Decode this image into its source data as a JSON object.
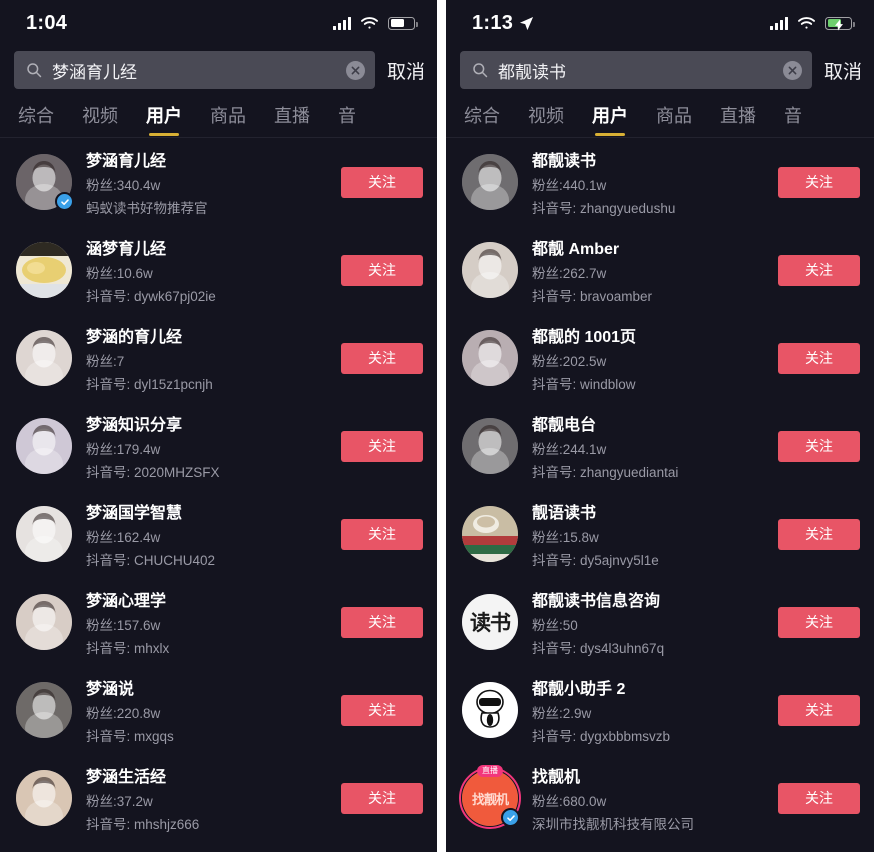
{
  "panels": [
    {
      "id": "left",
      "status": {
        "time": "1:04",
        "location_arrow": false,
        "battery_charging": false,
        "battery_level": 60
      },
      "search": {
        "value": "梦涵育儿经",
        "placeholder": "搜索",
        "cancel_label": "取消",
        "search_icon": "search-icon",
        "clear_icon": "clear-circle-icon"
      },
      "tabs": [
        {
          "label": "综合",
          "active": false
        },
        {
          "label": "视频",
          "active": false
        },
        {
          "label": "用户",
          "active": true
        },
        {
          "label": "商品",
          "active": false
        },
        {
          "label": "直播",
          "active": false
        },
        {
          "label": "音",
          "active": false
        }
      ],
      "follow_label": "关注",
      "users": [
        {
          "name": "梦涵育儿经",
          "fans": "粉丝:340.4w",
          "sub": "蚂蚁读书好物推荐官",
          "verified": true,
          "live": false,
          "avatar_kind": "photo",
          "avatar_color": "#6b6468",
          "avatar_text": ""
        },
        {
          "name": "涵梦育儿经",
          "fans": "粉丝:10.6w",
          "sub": "抖音号: dywk67pj02ie",
          "verified": false,
          "live": false,
          "avatar_kind": "food",
          "avatar_color": "#e4cf86",
          "avatar_text": ""
        },
        {
          "name": "梦涵的育儿经",
          "fans": "粉丝:7",
          "sub": "抖音号: dyl15z1pcnjh",
          "verified": false,
          "live": false,
          "avatar_kind": "photo",
          "avatar_color": "#ded6d2",
          "avatar_text": ""
        },
        {
          "name": "梦涵知识分享",
          "fans": "粉丝:179.4w",
          "sub": "抖音号: 2020MHZSFX",
          "verified": false,
          "live": false,
          "avatar_kind": "photo",
          "avatar_color": "#cfc8d6",
          "avatar_text": ""
        },
        {
          "name": "梦涵国学智慧",
          "fans": "粉丝:162.4w",
          "sub": "抖音号: CHUCHU402",
          "verified": false,
          "live": false,
          "avatar_kind": "photo",
          "avatar_color": "#e6e2e0",
          "avatar_text": ""
        },
        {
          "name": "梦涵心理学",
          "fans": "粉丝:157.6w",
          "sub": "抖音号: mhxlx",
          "verified": false,
          "live": false,
          "avatar_kind": "photo",
          "avatar_color": "#d8cdc6",
          "avatar_text": ""
        },
        {
          "name": "梦涵说",
          "fans": "粉丝:220.8w",
          "sub": "抖音号: mxgqs",
          "verified": false,
          "live": false,
          "avatar_kind": "photo",
          "avatar_color": "#6e6a68",
          "avatar_text": ""
        },
        {
          "name": "梦涵生活经",
          "fans": "粉丝:37.2w",
          "sub": "抖音号: mhshjz666",
          "verified": false,
          "live": false,
          "avatar_kind": "photo",
          "avatar_color": "#d9c6b4",
          "avatar_text": ""
        }
      ]
    },
    {
      "id": "right",
      "status": {
        "time": "1:13",
        "location_arrow": true,
        "battery_charging": true,
        "battery_level": 62
      },
      "search": {
        "value": "都靓读书",
        "placeholder": "搜索",
        "cancel_label": "取消",
        "search_icon": "search-icon",
        "clear_icon": "clear-circle-icon"
      },
      "tabs": [
        {
          "label": "综合",
          "active": false
        },
        {
          "label": "视频",
          "active": false
        },
        {
          "label": "用户",
          "active": true
        },
        {
          "label": "商品",
          "active": false
        },
        {
          "label": "直播",
          "active": false
        },
        {
          "label": "音",
          "active": false
        }
      ],
      "follow_label": "关注",
      "users": [
        {
          "name": "都靓读书",
          "fans": "粉丝:440.1w",
          "sub": "抖音号: zhangyuedushu",
          "verified": false,
          "live": false,
          "avatar_kind": "photo",
          "avatar_color": "#6f6d70",
          "avatar_text": ""
        },
        {
          "name": "都靓 Amber",
          "fans": "粉丝:262.7w",
          "sub": "抖音号: bravoamber",
          "verified": false,
          "live": false,
          "avatar_kind": "photo",
          "avatar_color": "#d5cdc6",
          "avatar_text": ""
        },
        {
          "name": "都靓的 1001页",
          "fans": "粉丝:202.5w",
          "sub": "抖音号: windblow",
          "verified": false,
          "live": false,
          "avatar_kind": "photo",
          "avatar_color": "#b9aeb2",
          "avatar_text": ""
        },
        {
          "name": "都靓电台",
          "fans": "粉丝:244.1w",
          "sub": "抖音号: zhangyuediantai",
          "verified": false,
          "live": false,
          "avatar_kind": "photo",
          "avatar_color": "#6f6d70",
          "avatar_text": ""
        },
        {
          "name": "靓语读书",
          "fans": "粉丝:15.8w",
          "sub": "抖音号: dy5ajnvy5l1e",
          "verified": false,
          "live": false,
          "avatar_kind": "books",
          "avatar_color": "#cbbfa8",
          "avatar_text": ""
        },
        {
          "name": "都靓读书信息咨询",
          "fans": "粉丝:50",
          "sub": "抖音号: dys4l3uhn67q",
          "verified": false,
          "live": false,
          "avatar_kind": "text",
          "avatar_color": "#f4f4f4",
          "avatar_text": "读书"
        },
        {
          "name": "都靓小助手 2",
          "fans": "粉丝:2.9w",
          "sub": "抖音号: dygxbbbmsvzb",
          "verified": false,
          "live": false,
          "avatar_kind": "mascot",
          "avatar_color": "#ffffff",
          "avatar_text": ""
        },
        {
          "name": "找靓机",
          "fans": "粉丝:680.0w",
          "sub": "深圳市找靓机科技有限公司",
          "verified": true,
          "live": true,
          "live_label": "直播",
          "avatar_kind": "brand",
          "avatar_color": "#f05a3c",
          "avatar_text": "找靓机"
        }
      ]
    }
  ],
  "theme": {
    "background": "#14141f",
    "divider": "#ffffff",
    "follow_button": "#e85566",
    "tab_active_underline": "#d8b035",
    "verified_badge": "#3aa0e8",
    "live_ring": "#f2367c",
    "text_primary": "#ffffff",
    "text_secondary": "#9a9aa6",
    "searchbox_bg": "#4a4a55"
  }
}
